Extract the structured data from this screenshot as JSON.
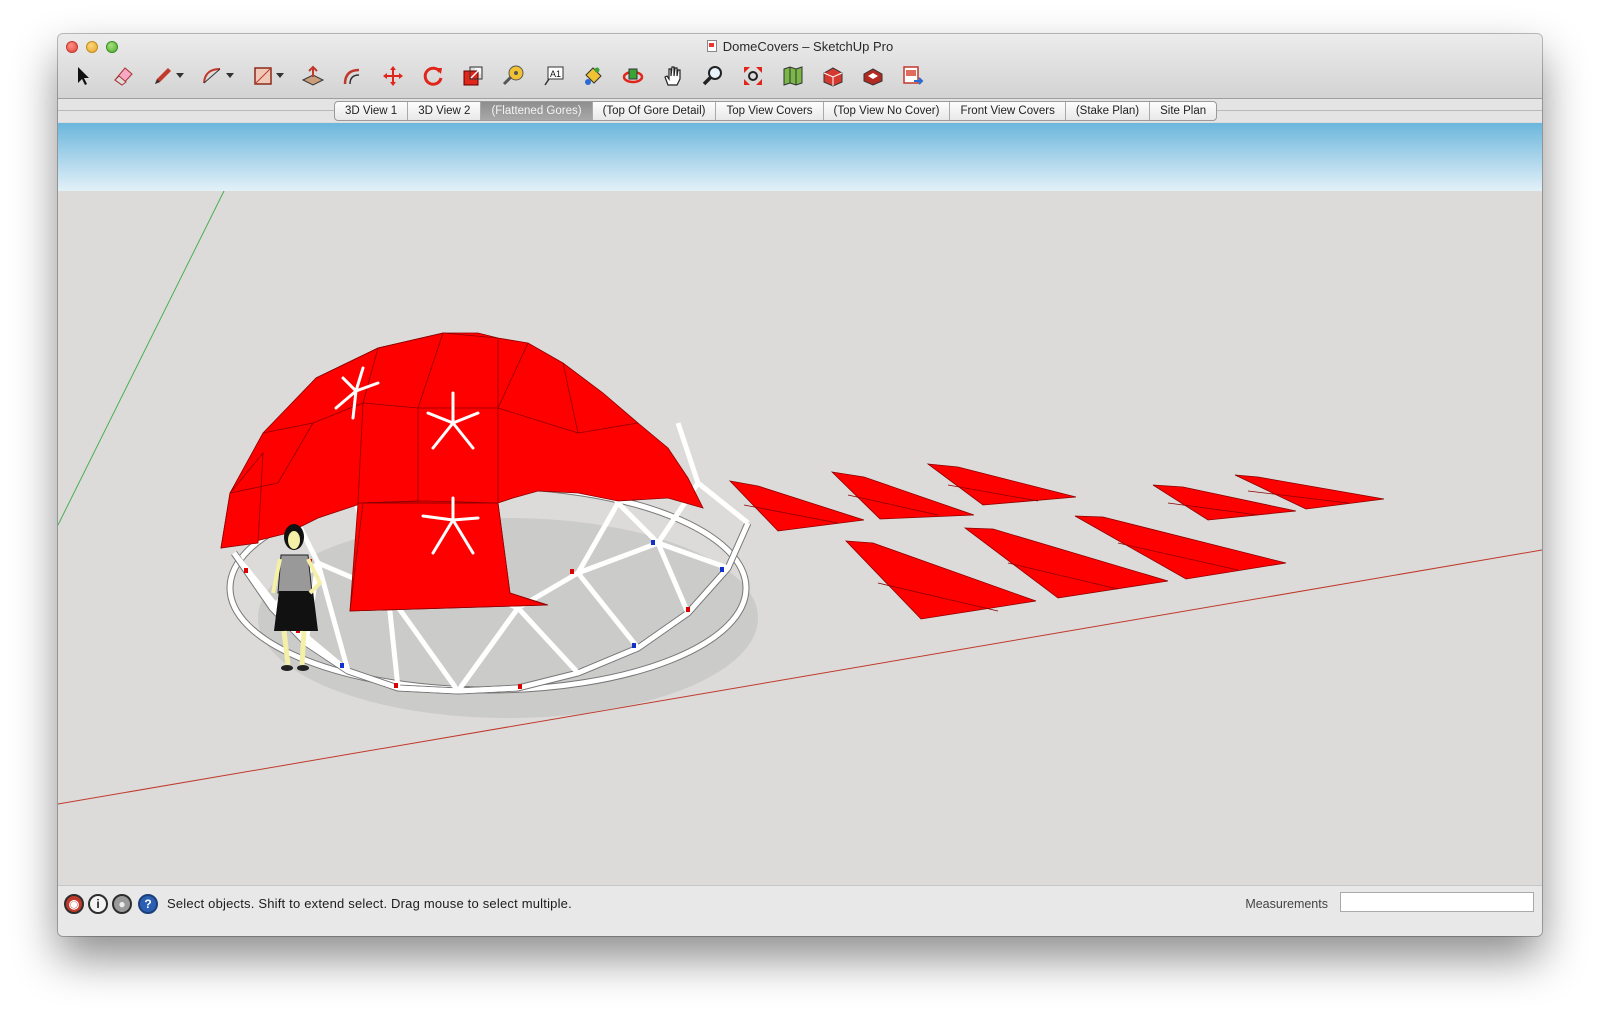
{
  "window": {
    "title": "DomeCovers – SketchUp Pro"
  },
  "toolbar": {
    "tools": [
      {
        "name": "select-tool",
        "icon": "arrow-icon"
      },
      {
        "name": "eraser-tool",
        "icon": "eraser-icon"
      },
      {
        "name": "pencil-tool",
        "icon": "pencil-icon"
      },
      {
        "name": "arc-tool",
        "icon": "arc-icon"
      },
      {
        "name": "rectangle-tool",
        "icon": "rectangle-icon"
      },
      {
        "name": "push-pull-tool",
        "icon": "push-pull-icon"
      },
      {
        "name": "offset-tool",
        "icon": "offset-icon"
      },
      {
        "name": "move-tool",
        "icon": "move-icon"
      },
      {
        "name": "rotate-tool",
        "icon": "rotate-icon"
      },
      {
        "name": "scale-tool",
        "icon": "scale-icon"
      },
      {
        "name": "tape-measure-tool",
        "icon": "tape-measure-icon"
      },
      {
        "name": "text-tool",
        "icon": "text-icon"
      },
      {
        "name": "paint-bucket-tool",
        "icon": "paint-bucket-icon"
      },
      {
        "name": "orbit-tool",
        "icon": "orbit-icon"
      },
      {
        "name": "pan-tool",
        "icon": "hand-icon"
      },
      {
        "name": "zoom-tool",
        "icon": "magnifier-icon"
      },
      {
        "name": "zoom-extents-tool",
        "icon": "zoom-extents-icon"
      },
      {
        "name": "add-location-tool",
        "icon": "map-icon"
      },
      {
        "name": "3d-warehouse-tool",
        "icon": "warehouse-icon"
      },
      {
        "name": "extension-warehouse-tool",
        "icon": "extension-icon"
      },
      {
        "name": "send-to-layout-tool",
        "icon": "layout-icon"
      }
    ],
    "text_tool_glyph": "A1"
  },
  "scenes": [
    {
      "label": "3D View 1",
      "active": false
    },
    {
      "label": "3D View 2",
      "active": false
    },
    {
      "label": "(Flattened Gores)",
      "active": true
    },
    {
      "label": "(Top Of Gore Detail)",
      "active": false
    },
    {
      "label": "Top View Covers",
      "active": false
    },
    {
      "label": "(Top View No Cover)",
      "active": false
    },
    {
      "label": "Front View Covers",
      "active": false
    },
    {
      "label": "(Stake Plan)",
      "active": false
    },
    {
      "label": "Site Plan",
      "active": false
    }
  ],
  "statusbar": {
    "status_text": "Select objects. Shift to extend select. Drag mouse to select multiple.",
    "icons": [
      "geo-location-icon",
      "credits-icon",
      "user-icon",
      "help-icon"
    ],
    "info_glyph": "i",
    "help_glyph": "?",
    "measurements_label": "Measurements",
    "measurements_value": ""
  },
  "colors": {
    "cover_red": "#ff0000",
    "sky_top": "#6cb6dc",
    "ground": "#dcdbd9",
    "strut": "#ffffff",
    "axis_green": "#4caf50",
    "axis_red": "#c0392b"
  }
}
